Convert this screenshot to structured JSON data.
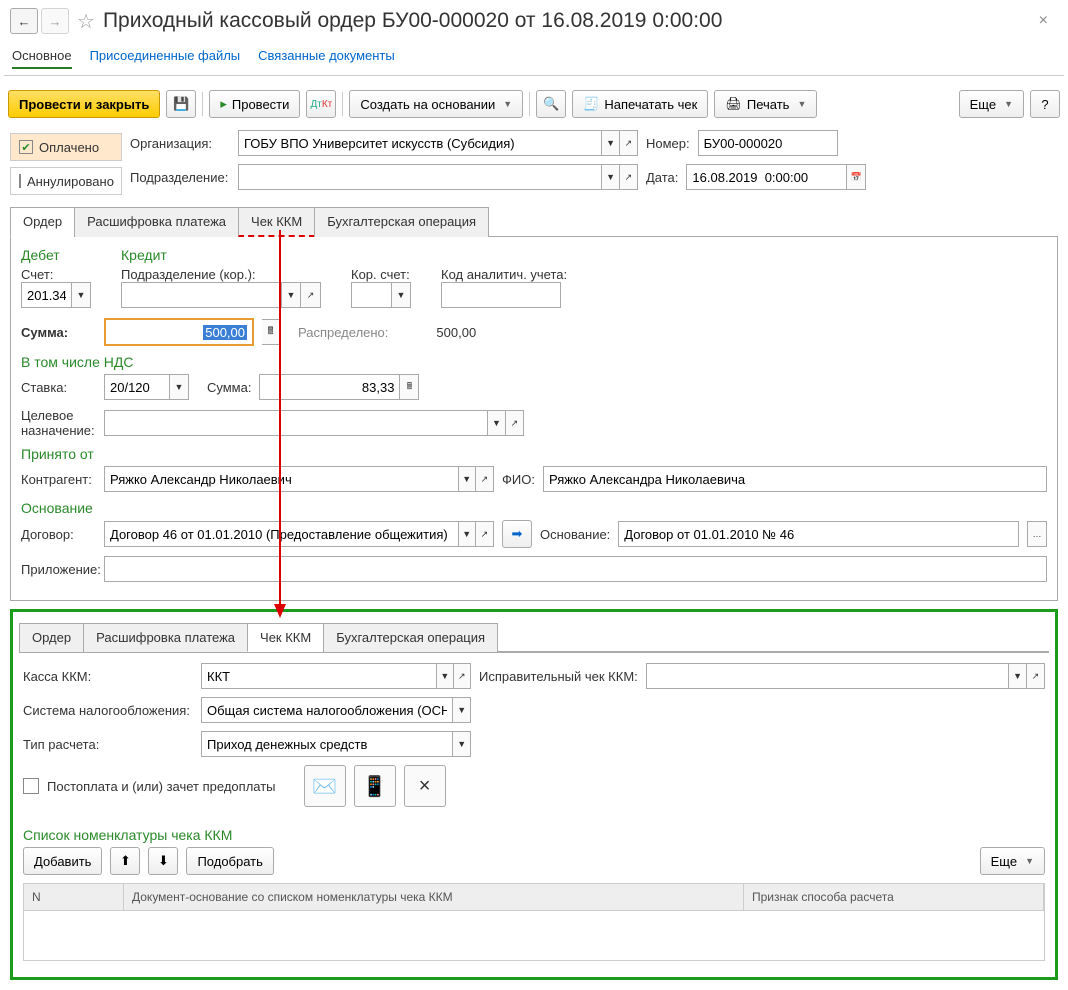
{
  "header": {
    "title": "Приходный кассовый ордер БУ00-000020 от 16.08.2019 0:00:00"
  },
  "sectionTabs": [
    "Основное",
    "Присоединенные файлы",
    "Связанные документы"
  ],
  "actions": {
    "postClose": "Провести и закрыть",
    "post": "Провести",
    "createBased": "Создать на основании",
    "printCheck": "Напечатать чек",
    "print": "Печать",
    "more": "Еще"
  },
  "status": {
    "paid": "Оплачено",
    "annul": "Аннулировано"
  },
  "org": {
    "label": "Организация:",
    "value": "ГОБУ ВПО Университет искусств (Субсидия)"
  },
  "number": {
    "label": "Номер:",
    "value": "БУ00-000020"
  },
  "division": {
    "label": "Подразделение:",
    "value": ""
  },
  "date": {
    "label": "Дата:",
    "value": "16.08.2019  0:00:00"
  },
  "tabs": [
    "Ордер",
    "Расшифровка платежа",
    "Чек ККМ",
    "Бухгалтерская операция"
  ],
  "order": {
    "debit": "Дебет",
    "credit": "Кредит",
    "account": {
      "label": "Счет:",
      "value": "201.34"
    },
    "corDiv": {
      "label": "Подразделение (кор.):",
      "value": ""
    },
    "corAcc": {
      "label": "Кор. счет:",
      "value": ""
    },
    "analytic": {
      "label": "Код аналитич. учета:",
      "value": ""
    },
    "sum": {
      "label": "Сумма:",
      "value": "500,00"
    },
    "distributed": {
      "label": "Распределено:",
      "value": "500,00"
    },
    "vatSection": "В том числе НДС",
    "rate": {
      "label": "Ставка:",
      "value": "20/120"
    },
    "vatSum": {
      "label": "Сумма:",
      "value": "83,33"
    },
    "purpose": {
      "label": "Целевое назначение:",
      "value": ""
    },
    "acceptedFrom": "Принято от",
    "contractor": {
      "label": "Контрагент:",
      "value": "Ряжко Александр Николаевич"
    },
    "fio": {
      "label": "ФИО:",
      "value": "Ряжко Александра Николаевича"
    },
    "basis": "Основание",
    "contract": {
      "label": "Договор:",
      "value": "Договор 46 от 01.01.2010 (Предоставление общежития)"
    },
    "basisField": {
      "label": "Основание:",
      "value": "Договор от 01.01.2010 № 46"
    },
    "attachment": {
      "label": "Приложение:",
      "value": ""
    }
  },
  "kkm": {
    "cashbox": {
      "label": "Касса ККМ:",
      "value": "ККТ"
    },
    "corrCheck": {
      "label": "Исправительный чек ККМ:",
      "value": ""
    },
    "taxSys": {
      "label": "Система налогообложения:",
      "value": "Общая система налогообложения (ОСН)"
    },
    "calcType": {
      "label": "Тип расчета:",
      "value": "Приход денежных средств"
    },
    "postpay": "Постоплата и (или) зачет предоплаты",
    "listTitle": "Список номенклатуры чека ККМ",
    "add": "Добавить",
    "pick": "Подобрать",
    "more": "Еще",
    "cols": {
      "n": "N",
      "doc": "Документ-основание со списком номенклатуры чека ККМ",
      "sign": "Признак способа расчета"
    }
  }
}
